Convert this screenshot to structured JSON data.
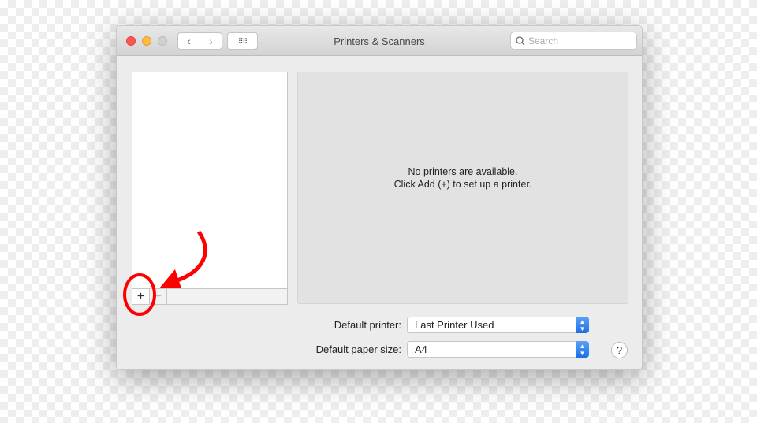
{
  "window": {
    "title": "Printers & Scanners",
    "search_placeholder": "Search"
  },
  "list": {
    "add_label": "+",
    "remove_label": "−"
  },
  "panel": {
    "line1": "No printers are available.",
    "line2": "Click Add (+) to set up a printer."
  },
  "settings": {
    "default_printer_label": "Default printer:",
    "default_printer_value": "Last Printer Used",
    "paper_size_label": "Default paper size:",
    "paper_size_value": "A4",
    "help_label": "?"
  },
  "annotation": {
    "color": "#ff0000"
  }
}
